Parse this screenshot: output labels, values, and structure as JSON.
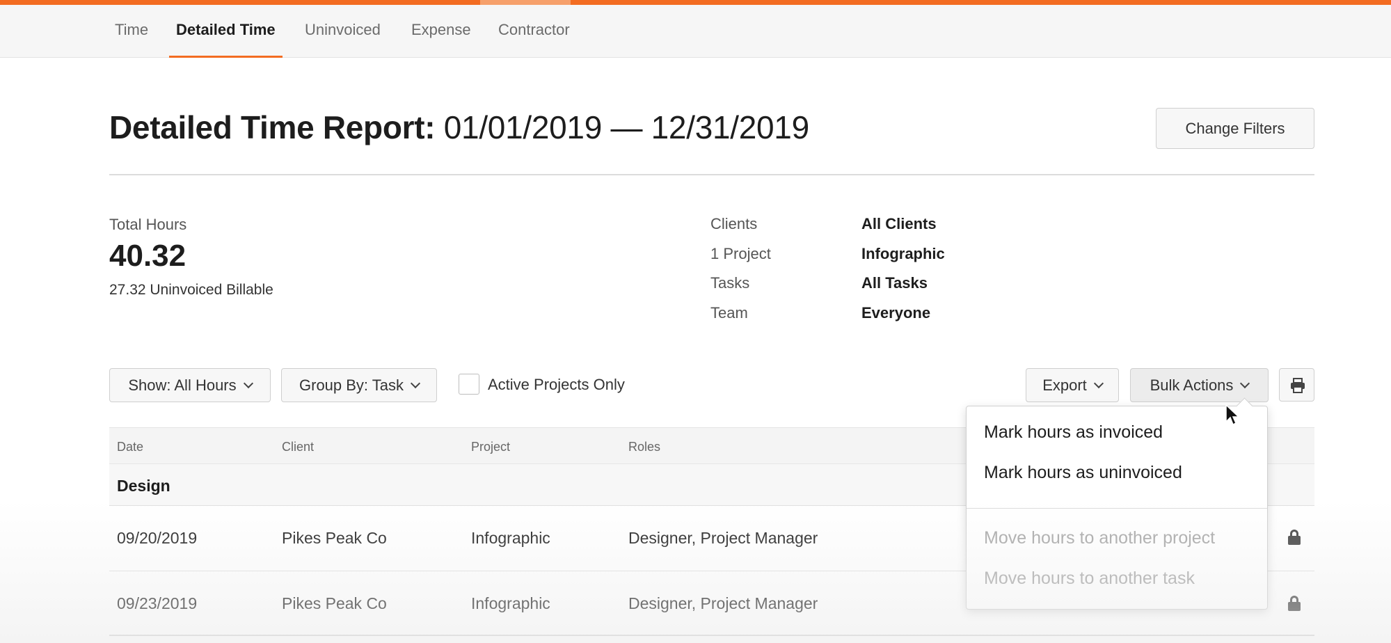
{
  "subnav": {
    "tabs": [
      {
        "label": "Time",
        "active": false
      },
      {
        "label": "Detailed Time",
        "active": true
      },
      {
        "label": "Uninvoiced",
        "active": false
      },
      {
        "label": "Expense",
        "active": false
      },
      {
        "label": "Contractor",
        "active": false
      }
    ]
  },
  "header": {
    "title_strong": "Detailed Time Report:",
    "title_range": "01/01/2019 — 12/31/2019",
    "change_filters_label": "Change Filters"
  },
  "summary": {
    "total_label": "Total Hours",
    "total_value": "40.32",
    "uninvoiced_text": "27.32 Uninvoiced Billable"
  },
  "filters": [
    {
      "label": "Clients",
      "value": "All Clients"
    },
    {
      "label": "1 Project",
      "value": "Infographic"
    },
    {
      "label": "Tasks",
      "value": "All Tasks"
    },
    {
      "label": "Team",
      "value": "Everyone"
    }
  ],
  "toolbar": {
    "show_label": "Show: All Hours",
    "group_label": "Group By: Task",
    "active_projects_label": "Active Projects Only",
    "active_projects_checked": false,
    "export_label": "Export",
    "bulk_actions_label": "Bulk Actions",
    "print_icon": "printer-icon"
  },
  "table": {
    "headers": [
      "Date",
      "Client",
      "Project",
      "Roles"
    ],
    "group": "Design",
    "rows": [
      {
        "date": "09/20/2019",
        "client": "Pikes Peak Co",
        "project": "Infographic",
        "roles": "Designer, Project Manager",
        "locked": true
      },
      {
        "date": "09/23/2019",
        "client": "Pikes Peak Co",
        "project": "Infographic",
        "roles": "Designer, Project Manager",
        "locked": true
      }
    ]
  },
  "bulk_menu": {
    "items": [
      {
        "label": "Mark hours as invoiced",
        "enabled": true
      },
      {
        "label": "Mark hours as uninvoiced",
        "enabled": true
      },
      {
        "label": "Move hours to another project",
        "enabled": false
      },
      {
        "label": "Move hours to another task",
        "enabled": false
      }
    ]
  },
  "colors": {
    "accent": "#f36c21",
    "text": "#1d1d1d",
    "muted": "#6b6b6b",
    "disabled": "#a9a9a9"
  }
}
